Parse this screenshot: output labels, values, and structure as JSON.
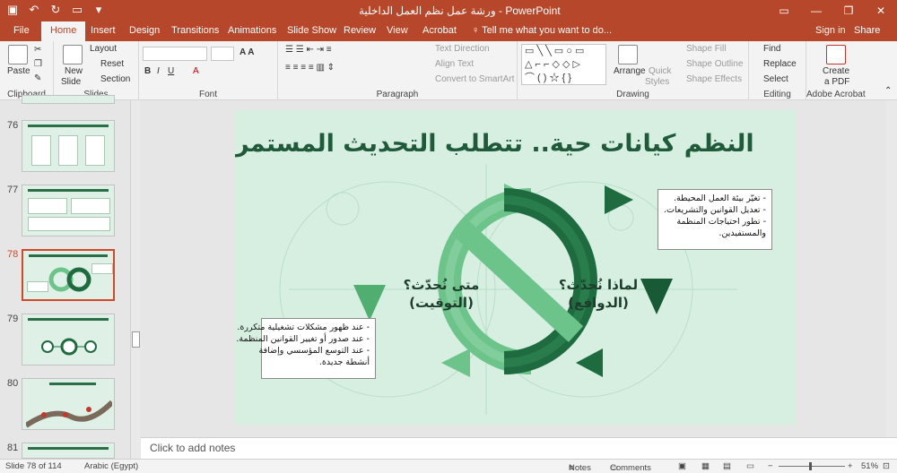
{
  "app": {
    "title": "ورشة عمل نظم العمل الداخلية - PowerPoint",
    "sign_in": "Sign in",
    "share": "Share",
    "tell_me": "Tell me what you want to do..."
  },
  "tabs": [
    "File",
    "Home",
    "Insert",
    "Design",
    "Transitions",
    "Animations",
    "Slide Show",
    "Review",
    "View",
    "Acrobat"
  ],
  "ribbon": {
    "clipboard": {
      "label": "Clipboard",
      "paste": "Paste"
    },
    "slides": {
      "label": "Slides",
      "new_slide_1": "New",
      "new_slide_2": "Slide",
      "layout": "Layout",
      "reset": "Reset",
      "section": "Section"
    },
    "font": {
      "label": "Font"
    },
    "paragraph": {
      "label": "Paragraph",
      "text_direction": "Text Direction",
      "align_text": "Align Text",
      "convert": "Convert to SmartArt"
    },
    "drawing": {
      "label": "Drawing",
      "arrange": "Arrange",
      "quick_styles_1": "Quick",
      "quick_styles_2": "Styles",
      "shape_fill": "Shape Fill",
      "shape_outline": "Shape Outline",
      "shape_effects": "Shape Effects"
    },
    "editing": {
      "label": "Editing",
      "find": "Find",
      "replace": "Replace",
      "select": "Select"
    },
    "acrobat": {
      "label": "Adobe Acrobat",
      "create_1": "Create",
      "create_2": "a PDF"
    }
  },
  "thumbnails": [
    {
      "num": "76"
    },
    {
      "num": "77"
    },
    {
      "num": "78"
    },
    {
      "num": "79"
    },
    {
      "num": "80"
    },
    {
      "num": "81"
    }
  ],
  "slide": {
    "title": "النظم كيانات حية.. تتطلب التحديث المستمر",
    "left_loop": {
      "line1": "متى نُحدّث؟",
      "line2": "(التوقيت)"
    },
    "right_loop": {
      "line1": "لماذا نُحدّث؟",
      "line2": "(الدوافع)"
    },
    "callout_right": [
      "- تغيّر بيئة العمل المحيطة.",
      "- تعديل القوانين والتشريعات.",
      "- تطور احتياجات المنظمة",
      "والمستفيدين."
    ],
    "callout_left": [
      "- عند ظهور مشكلات تشغيلية متكررة.",
      "- عند صدور أو تغيير القوانين المنظمة.",
      "- عند التوسع المؤسسي وإضافة",
      "أنشطة جديدة."
    ],
    "colors": {
      "dark": "#1e6b40",
      "light": "#6cc48a",
      "bg": "#d6efe1"
    }
  },
  "notes_placeholder": "Click to add notes",
  "status": {
    "slide_of": "Slide 78 of 114",
    "language": "Arabic (Egypt)",
    "notes": "Notes",
    "comments": "Comments",
    "zoom": "51%"
  }
}
